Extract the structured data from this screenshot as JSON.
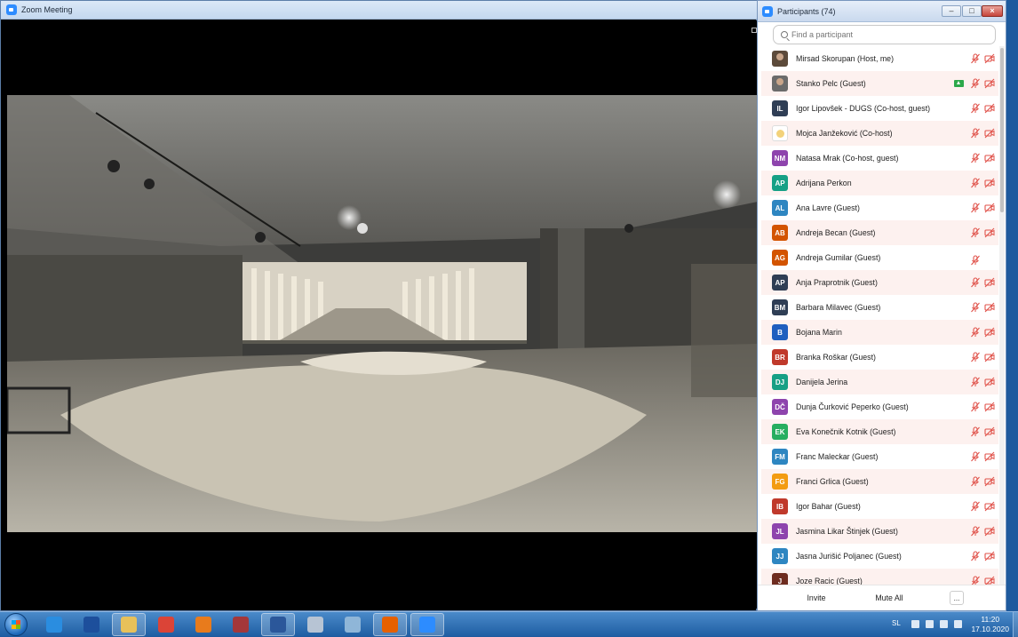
{
  "zoom_window": {
    "title": "Zoom Meeting"
  },
  "participants_panel": {
    "title": "Participants (74)",
    "search_placeholder": "Find a participant",
    "buttons": {
      "invite": "Invite",
      "mute_all": "Mute All",
      "more": "..."
    },
    "participants": [
      {
        "name": "Mirsad Skorupan (Host, me)",
        "avatar": "photo",
        "initials": "",
        "color": "#5c4a3a",
        "sharing": false,
        "video_icon": true
      },
      {
        "name": "Stanko Pelc (Guest)",
        "avatar": "photo",
        "initials": "",
        "color": "#6b6b6b",
        "sharing": true,
        "video_icon": true
      },
      {
        "name": "Igor Lipovšek - DUGS (Co-host, guest)",
        "avatar": "initials",
        "initials": "IL",
        "color": "#2f3e55",
        "sharing": false,
        "video_icon": true
      },
      {
        "name": "Mojca Janžeković (Co-host)",
        "avatar": "cartoon",
        "initials": "",
        "color": "#ffffff",
        "sharing": false,
        "video_icon": true
      },
      {
        "name": "Natasa Mrak (Co-host, guest)",
        "avatar": "initials",
        "initials": "NM",
        "color": "#8e44ad",
        "sharing": false,
        "video_icon": true
      },
      {
        "name": "Adrijana Perkon",
        "avatar": "initials",
        "initials": "AP",
        "color": "#16a085",
        "sharing": false,
        "video_icon": true
      },
      {
        "name": "Ana Lavre (Guest)",
        "avatar": "initials",
        "initials": "AL",
        "color": "#2e86c1",
        "sharing": false,
        "video_icon": true
      },
      {
        "name": "Andreja Becan (Guest)",
        "avatar": "initials",
        "initials": "AB",
        "color": "#d35400",
        "sharing": false,
        "video_icon": true
      },
      {
        "name": "Andreja Gumilar (Guest)",
        "avatar": "initials",
        "initials": "AG",
        "color": "#d35400",
        "sharing": false,
        "video_icon": false
      },
      {
        "name": "Anja Praprotnik (Guest)",
        "avatar": "initials",
        "initials": "AP",
        "color": "#2f3e55",
        "sharing": false,
        "video_icon": true
      },
      {
        "name": "Barbara Milavec (Guest)",
        "avatar": "initials",
        "initials": "BM",
        "color": "#2f3e55",
        "sharing": false,
        "video_icon": true
      },
      {
        "name": "Bojana Marin",
        "avatar": "initials",
        "initials": "B",
        "color": "#1f5fbf",
        "sharing": false,
        "video_icon": true
      },
      {
        "name": "Branka Roškar (Guest)",
        "avatar": "initials",
        "initials": "BR",
        "color": "#c0392b",
        "sharing": false,
        "video_icon": true
      },
      {
        "name": "Danijela Jerina",
        "avatar": "initials",
        "initials": "DJ",
        "color": "#16a085",
        "sharing": false,
        "video_icon": true
      },
      {
        "name": "Dunja Čurković Peperko (Guest)",
        "avatar": "initials",
        "initials": "DČ",
        "color": "#8e44ad",
        "sharing": false,
        "video_icon": true
      },
      {
        "name": "Eva Konečnik Kotnik (Guest)",
        "avatar": "initials",
        "initials": "EK",
        "color": "#27ae60",
        "sharing": false,
        "video_icon": true
      },
      {
        "name": "Franc Maleckar (Guest)",
        "avatar": "initials",
        "initials": "FM",
        "color": "#2e86c1",
        "sharing": false,
        "video_icon": true
      },
      {
        "name": "Franci Grlica (Guest)",
        "avatar": "initials",
        "initials": "FG",
        "color": "#f39c12",
        "sharing": false,
        "video_icon": true
      },
      {
        "name": "Igor Bahar (Guest)",
        "avatar": "initials",
        "initials": "IB",
        "color": "#c0392b",
        "sharing": false,
        "video_icon": true
      },
      {
        "name": "Jasmina Likar Štinjek (Guest)",
        "avatar": "initials",
        "initials": "JL",
        "color": "#8e44ad",
        "sharing": false,
        "video_icon": true
      },
      {
        "name": "Jasna Jurišić Poljanec (Guest)",
        "avatar": "initials",
        "initials": "JJ",
        "color": "#2e86c1",
        "sharing": false,
        "video_icon": true
      },
      {
        "name": "Joze Racic (Guest)",
        "avatar": "initials",
        "initials": "J",
        "color": "#6e2c1f",
        "sharing": false,
        "video_icon": true
      }
    ]
  },
  "taskbar": {
    "apps": [
      {
        "name": "internet-explorer-icon",
        "color": "#2a8de0",
        "active": false
      },
      {
        "name": "google-earth-icon",
        "color": "#1d4f9c",
        "active": false
      },
      {
        "name": "file-explorer-icon",
        "color": "#e8c15a",
        "active": true
      },
      {
        "name": "chrome-icon",
        "color": "#db4437",
        "active": false
      },
      {
        "name": "outlook-icon",
        "color": "#e87b1c",
        "active": false
      },
      {
        "name": "access-icon",
        "color": "#a4373a",
        "active": false
      },
      {
        "name": "word-icon",
        "color": "#2b579a",
        "active": true
      },
      {
        "name": "calculator-icon",
        "color": "#b7c4d4",
        "active": false
      },
      {
        "name": "notepad-icon",
        "color": "#8fb6d8",
        "active": false
      },
      {
        "name": "firefox-icon",
        "color": "#e66000",
        "active": true
      },
      {
        "name": "zoom-icon",
        "color": "#2d8cff",
        "active": true
      }
    ],
    "language": "SL",
    "time": "11:20",
    "date": "17.10.2020"
  }
}
